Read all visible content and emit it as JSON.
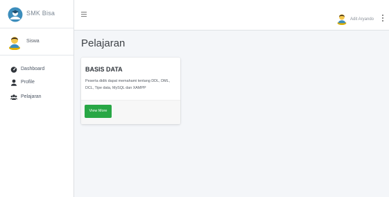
{
  "brand": {
    "name": "SMK Bisa",
    "logo_icon": "graduation-cap-icon",
    "accent": "#3c8dbc"
  },
  "sidebar": {
    "user_name": "Siswa",
    "items": [
      {
        "label": "Dashboard",
        "icon": "dashboard-gauge-icon"
      },
      {
        "label": "Profile",
        "icon": "user-icon"
      },
      {
        "label": "Pelajaran",
        "icon": "users-icon"
      }
    ]
  },
  "topbar": {
    "user_name": "Adit Aryando",
    "menu_icon": "hamburger-icon",
    "more_icon": "more-vertical-icon"
  },
  "main": {
    "page_title": "Pelajaran",
    "card": {
      "title": "BASIS DATA",
      "description": "Peserta didik dapat memahami tentang DDL, DML, DCL, Tipe data, MySQL dan XAMPP",
      "button_label": "View More",
      "button_color": "#28a745"
    }
  }
}
